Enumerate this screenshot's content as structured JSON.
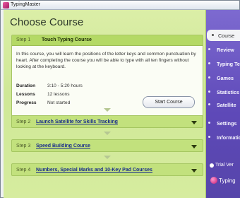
{
  "window": {
    "title": "TypingMaster"
  },
  "page": {
    "title": "Choose Course"
  },
  "step1": {
    "number": "Step 1",
    "title": "Touch Typing Course",
    "description": "In this course, you will learn the positions of the letter keys and common punctuation by heart. After completing the course you will be able to type with all ten fingers without looking at the keyboard.",
    "duration_label": "Duration",
    "duration_value": "3:10 - 5:20 hours",
    "lessons_label": "Lessons",
    "lessons_value": "12 lessons",
    "progress_label": "Progress",
    "progress_value": "Not started",
    "start_button": "Start Course"
  },
  "steps": [
    {
      "number": "Step 2",
      "title": "Launch Satellite for Skills Tracking"
    },
    {
      "number": "Step 3",
      "title": "Speed Building Course"
    },
    {
      "number": "Step 4",
      "title": "Numbers, Special Marks and 10-Key Pad Courses"
    }
  ],
  "sidebar": {
    "items": [
      {
        "label": "Course"
      },
      {
        "label": "Review"
      },
      {
        "label": "Typing Te"
      },
      {
        "label": "Games"
      },
      {
        "label": "Statistics"
      },
      {
        "label": "Satellite"
      },
      {
        "label": "Settings"
      },
      {
        "label": "Informatio"
      }
    ],
    "trial_label": "Trial Ver",
    "brand_label": "Typing"
  },
  "colors": {
    "accent_green": "#b4d965",
    "sidebar_purple": "#5e49b8",
    "link_blue": "#1a2e8c"
  }
}
